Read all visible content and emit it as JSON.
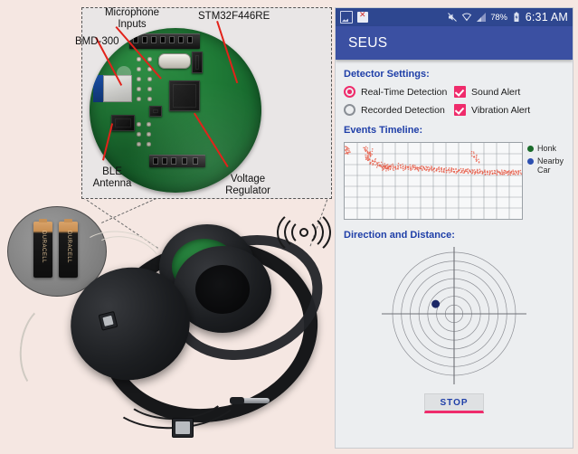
{
  "figure": {
    "background_color": "#f5e7e2",
    "hardware": {
      "callout_labels": [
        {
          "id": "microphone-inputs",
          "text": "Microphone\nInputs"
        },
        {
          "id": "bmd-300",
          "text": "BMD-300"
        },
        {
          "id": "stm32f446re",
          "text": "STM32F446RE"
        },
        {
          "id": "ble-antenna",
          "text": "BLE\nAntenna"
        },
        {
          "id": "voltage-regulator",
          "text": "Voltage\nRegulator"
        }
      ],
      "label_microphone_line1": "Microphone",
      "label_microphone_line2": "Inputs",
      "label_bmd300": "BMD-300",
      "label_stm32": "STM32F446RE",
      "label_ble_line1": "BLE",
      "label_ble_line2": "Antenna",
      "label_vreg_line1": "Voltage",
      "label_vreg_line2": "Regulator",
      "battery_brand": "DURACELL",
      "leader_color": "#e2221a",
      "pcb_color": "#1f7a36"
    }
  },
  "phone": {
    "statusbar": {
      "icons_left": [
        "image-icon",
        "document-error-icon"
      ],
      "icons_right": [
        "mute-icon",
        "wifi-icon",
        "cell-signal-icon"
      ],
      "battery_percent": "78%",
      "battery_icon": "battery-charging-icon",
      "time": "6:31 AM",
      "background_color": "#2e4790"
    },
    "appbar": {
      "title": "SEUS",
      "background_color": "#3b50a2"
    },
    "detector_settings": {
      "title": "Detector Settings:",
      "options": [
        {
          "name": "real-time-detection",
          "label": "Real-Time Detection",
          "control": "radio",
          "checked": true
        },
        {
          "name": "sound-alert",
          "label": "Sound Alert",
          "control": "checkbox",
          "checked": true
        },
        {
          "name": "recorded-detection",
          "label": "Recorded Detection",
          "control": "radio",
          "checked": false
        },
        {
          "name": "vibration-alert",
          "label": "Vibration Alert",
          "control": "checkbox",
          "checked": true
        }
      ],
      "accent_color": "#ef2b6b"
    },
    "events_timeline": {
      "title": "Events Timeline:",
      "legend": [
        {
          "label": "Honk",
          "color": "#1a6b2a"
        },
        {
          "label": "Nearby Car",
          "color": "#2c4fb0"
        }
      ]
    },
    "direction_distance": {
      "title": "Direction and Distance:",
      "marker_color": "#1b2766",
      "rings": 7
    },
    "stop_button": {
      "label": "STOP",
      "text_color": "#1f3fa8",
      "underline_color": "#ef2b6b"
    }
  },
  "chart_data": [
    {
      "type": "scatter",
      "name": "events-timeline",
      "title": "Events Timeline:",
      "xlabel": "",
      "ylabel": "",
      "grid": true,
      "grid_cols": 14,
      "grid_rows": 7,
      "xlim": [
        0,
        100
      ],
      "ylim": [
        0,
        100
      ],
      "legend_position": "right",
      "series": [
        {
          "name": "Honk",
          "color": "#1a6b2a",
          "x": [],
          "y": []
        },
        {
          "name": "Nearby Car",
          "color": "#2c4fb0",
          "x": [],
          "y": []
        },
        {
          "name": "detections",
          "color": "#e8604c",
          "x": [
            0.5,
            1.2,
            1.8,
            2.4,
            1.1,
            0.8,
            1.6,
            11.5,
            12.1,
            12.8,
            13.4,
            14.0,
            14.6,
            15.2,
            12.4,
            13.0,
            13.7,
            14.3,
            11.8,
            12.6,
            13.2,
            13.9,
            14.8,
            15.6,
            16.2,
            16.9,
            17.5,
            18.1,
            18.8,
            19.4,
            20.0,
            20.7,
            21.3,
            21.9,
            22.6,
            23.2,
            23.8,
            24.5,
            25.1,
            22.0,
            22.8,
            23.5,
            24.2,
            24.9,
            25.6,
            26.3,
            27.0,
            27.7,
            28.4,
            29.1,
            29.8,
            30.5,
            31.2,
            31.9,
            32.6,
            33.3,
            34.0,
            34.7,
            35.4,
            36.1,
            36.8,
            37.5,
            38.2,
            38.9,
            39.6,
            40.3,
            41.0,
            41.7,
            42.4,
            43.1,
            43.8,
            44.5,
            45.2,
            45.9,
            46.6,
            47.3,
            48.0,
            48.7,
            49.4,
            50.1,
            50.8,
            51.5,
            52.2,
            52.9,
            53.6,
            54.3,
            55.0,
            55.7,
            56.4,
            57.1,
            57.8,
            58.5,
            59.2,
            59.9,
            60.6,
            61.3,
            62.0,
            62.7,
            63.4,
            64.1,
            64.8,
            65.5,
            66.2,
            66.9,
            67.6,
            68.3,
            69.0,
            69.7,
            70.4,
            71.1,
            71.8,
            72.5,
            73.2,
            73.9,
            74.6,
            75.3,
            76.0,
            76.7,
            77.4,
            78.1,
            78.8,
            79.5,
            80.2,
            80.9,
            81.6,
            82.3,
            83.0,
            83.7,
            84.4,
            85.1,
            85.8,
            86.5,
            87.2,
            87.9,
            88.6,
            89.3,
            90.0,
            90.7,
            91.4,
            92.1,
            92.8,
            93.5,
            94.2,
            94.9,
            95.6,
            96.3,
            97.0,
            97.7,
            98.4,
            99.1,
            72.0,
            72.6,
            73.3,
            74.0,
            74.7,
            75.4
          ],
          "y": [
            92,
            94,
            88,
            90,
            86,
            93,
            89,
            94,
            91,
            88,
            85,
            83,
            87,
            90,
            80,
            78,
            82,
            85,
            92,
            86,
            79,
            76,
            74,
            73,
            75,
            77,
            74,
            72,
            70,
            71,
            73,
            70,
            68,
            69,
            71,
            68,
            67,
            69,
            70,
            66,
            68,
            67,
            65,
            66,
            68,
            70,
            69,
            67,
            66,
            68,
            67,
            69,
            71,
            70,
            68,
            67,
            66,
            68,
            67,
            69,
            68,
            66,
            67,
            69,
            68,
            67,
            66,
            65,
            67,
            66,
            68,
            67,
            66,
            65,
            67,
            66,
            65,
            67,
            66,
            65,
            64,
            66,
            65,
            64,
            66,
            65,
            64,
            63,
            65,
            64,
            63,
            65,
            64,
            63,
            65,
            64,
            63,
            62,
            64,
            63,
            62,
            64,
            63,
            62,
            64,
            63,
            62,
            64,
            63,
            62,
            61,
            63,
            62,
            61,
            63,
            62,
            61,
            63,
            62,
            61,
            60,
            62,
            61,
            60,
            62,
            61,
            60,
            62,
            61,
            60,
            62,
            61,
            60,
            62,
            61,
            60,
            62,
            61,
            60,
            62,
            61,
            60,
            62,
            61,
            60,
            62,
            61,
            60,
            62,
            61,
            88,
            84,
            80,
            82,
            78,
            76
          ]
        }
      ]
    },
    {
      "type": "polar-scatter",
      "name": "direction-and-distance",
      "title": "Direction and Distance:",
      "rings": 7,
      "axes": "crosshair",
      "points": [
        {
          "label": "Nearby Car",
          "x": -0.3,
          "y": 0.16,
          "color": "#1b2766",
          "size": 9
        }
      ]
    }
  ]
}
